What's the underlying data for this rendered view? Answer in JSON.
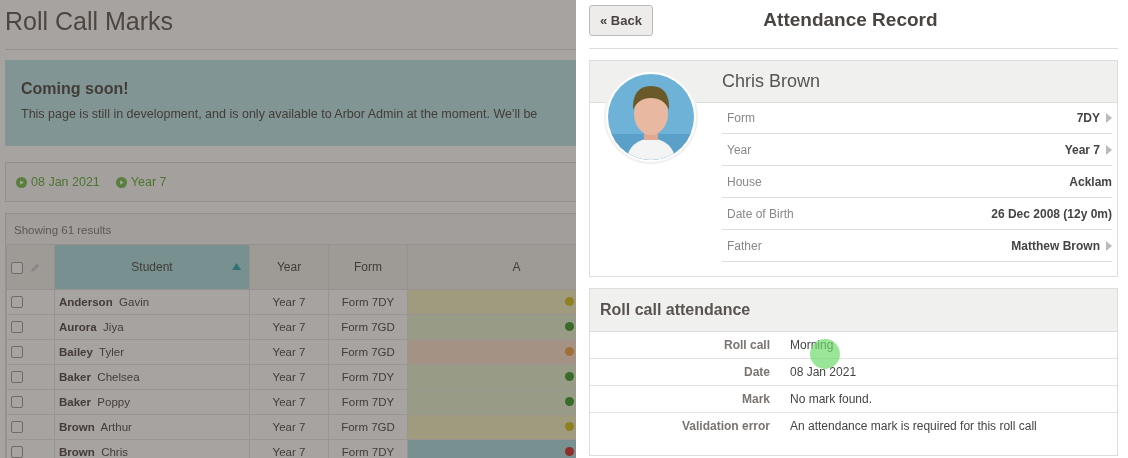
{
  "page": {
    "title": "Roll Call Marks"
  },
  "notice": {
    "heading": "Coming soon!",
    "text": "This page is still in development, and is only available to Arbor Admin at the moment. We'll be"
  },
  "filters": [
    "08 Jan 2021",
    "Year 7"
  ],
  "results": {
    "summary": "Showing 61 results"
  },
  "table": {
    "select_all": {
      "checked": false
    },
    "columns": [
      {
        "label": "Student",
        "sorted": true
      },
      {
        "label": "Year",
        "sorted": false
      },
      {
        "label": "Form",
        "sorted": false
      },
      {
        "label": "A",
        "sorted": false
      }
    ],
    "rows": [
      {
        "surname": "Anderson",
        "forename": "Gavin",
        "year": "Year 7",
        "form": "Form 7DY",
        "kind": "late",
        "checked": false,
        "selected": false
      },
      {
        "surname": "Aurora",
        "forename": "Jiya",
        "year": "Year 7",
        "form": "Form 7GD",
        "kind": "present",
        "checked": false,
        "selected": false
      },
      {
        "surname": "Bailey",
        "forename": "Tyler",
        "year": "Year 7",
        "form": "Form 7GD",
        "kind": "other",
        "checked": false,
        "selected": false
      },
      {
        "surname": "Baker",
        "forename": "Chelsea",
        "year": "Year 7",
        "form": "Form 7DY",
        "kind": "present",
        "checked": false,
        "selected": false
      },
      {
        "surname": "Baker",
        "forename": "Poppy",
        "year": "Year 7",
        "form": "Form 7DY",
        "kind": "present",
        "checked": false,
        "selected": false
      },
      {
        "surname": "Brown",
        "forename": "Arthur",
        "year": "Year 7",
        "form": "Form 7GD",
        "kind": "late",
        "checked": false,
        "selected": false
      },
      {
        "surname": "Brown",
        "forename": "Chris",
        "year": "Year 7",
        "form": "Form 7DY",
        "kind": "missing",
        "checked": false,
        "selected": true
      }
    ]
  },
  "panel": {
    "back": "« Back",
    "title": "Attendance Record",
    "student": {
      "name": "Chris Brown",
      "fields": [
        {
          "label": "Form",
          "value": "7DY",
          "link": true
        },
        {
          "label": "Year",
          "value": "Year 7",
          "link": true
        },
        {
          "label": "House",
          "value": "Acklam",
          "link": false
        },
        {
          "label": "Date of Birth",
          "value": "26 Dec 2008 (12y 0m)",
          "link": false
        },
        {
          "label": "Father",
          "value": "Matthew Brown",
          "link": true
        }
      ]
    },
    "roll_call": {
      "heading": "Roll call attendance",
      "fields": [
        {
          "label": "Roll call",
          "value": "Morning"
        },
        {
          "label": "Date",
          "value": "08 Jan 2021"
        },
        {
          "label": "Mark",
          "value": "No mark found."
        },
        {
          "label": "Validation error",
          "value": "An attendance mark is required for this roll call"
        }
      ]
    }
  }
}
